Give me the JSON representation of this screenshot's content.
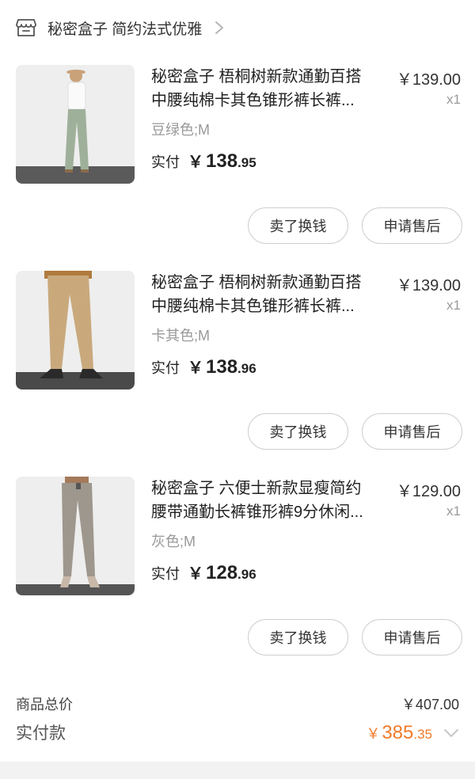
{
  "shop": {
    "name": "秘密盒子 简约法式优雅"
  },
  "items": [
    {
      "title": "秘密盒子 梧桐树新款通勤百搭\n中腰纯棉卡其色锥形裤长裤...",
      "price": "￥139.00",
      "qty": "x1",
      "variant": "豆绿色;M",
      "paid_label": "实付",
      "paid_yen": "￥",
      "paid_int": "138",
      "paid_dec": ".95",
      "btn_sell": "卖了换钱",
      "btn_after": "申请售后",
      "pants_color": "#9fb09a"
    },
    {
      "title": "秘密盒子 梧桐树新款通勤百搭\n中腰纯棉卡其色锥形裤长裤...",
      "price": "￥139.00",
      "qty": "x1",
      "variant": "卡其色;M",
      "paid_label": "实付",
      "paid_yen": "￥",
      "paid_int": "138",
      "paid_dec": ".96",
      "btn_sell": "卖了换钱",
      "btn_after": "申请售后",
      "pants_color": "#c9a97c"
    },
    {
      "title": "秘密盒子 六便士新款显瘦简约\n腰带通勤长裤锥形裤9分休闲...",
      "price": "￥129.00",
      "qty": "x1",
      "variant": "灰色;M",
      "paid_label": "实付",
      "paid_yen": "￥",
      "paid_int": "128",
      "paid_dec": ".96",
      "btn_sell": "卖了换钱",
      "btn_after": "申请售后",
      "pants_color": "#9e978e"
    }
  ],
  "summary": {
    "total_label": "商品总价",
    "total_value": "￥407.00",
    "paid_label": "实付款",
    "paid_yen": "￥",
    "paid_int": "385",
    "paid_dec": ".35"
  },
  "colors": {
    "accent": "#f07a2a"
  },
  "icons": {
    "shop": "store-icon",
    "chevron": "chevron-right-icon",
    "expand": "chevron-down-icon"
  }
}
